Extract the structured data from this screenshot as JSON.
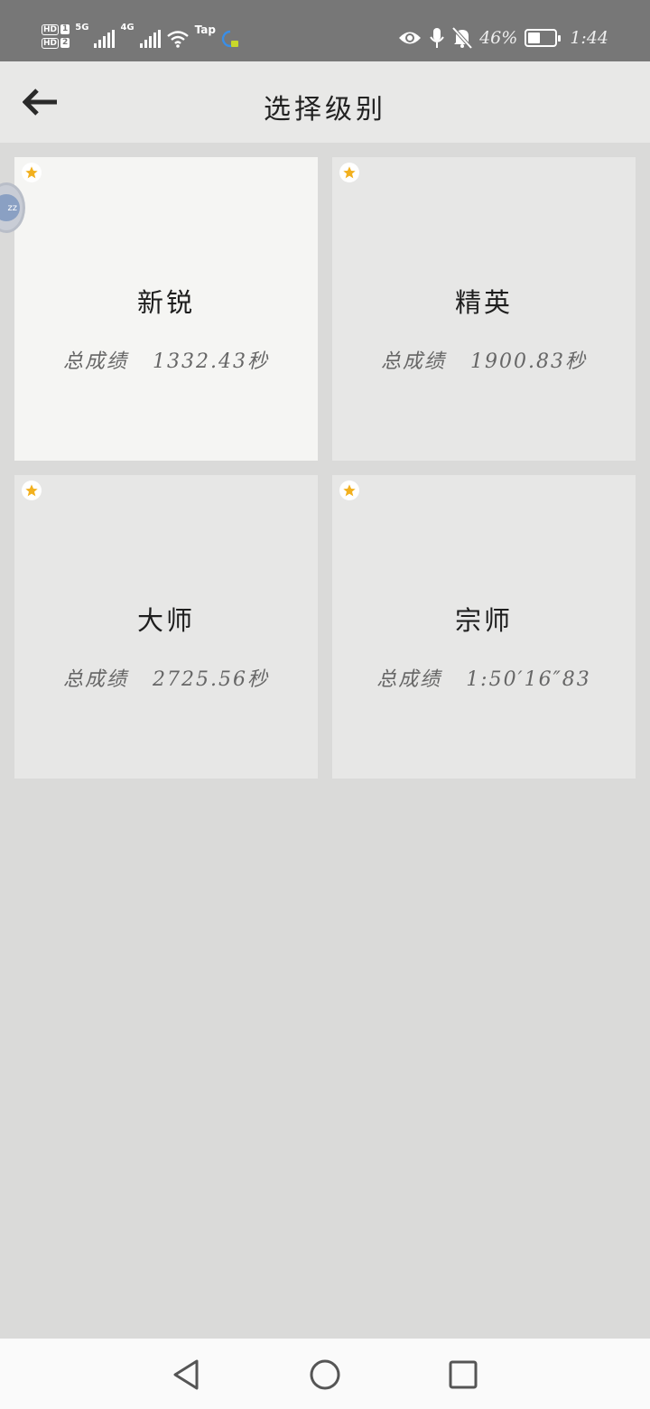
{
  "status_bar": {
    "sim1": "HD",
    "sim1_num": "1",
    "sim2": "HD",
    "sim2_num": "2",
    "network1": "5G",
    "network2": "4G",
    "tap_label": "Tap",
    "battery_percent_text": "46%",
    "battery_level": 0.46,
    "time": "1:44"
  },
  "header": {
    "title": "选择级别",
    "back_icon": "arrow-left-icon"
  },
  "levels": [
    {
      "name": "新锐",
      "score_label": "总成绩",
      "score": "1332.43秒",
      "starred": true
    },
    {
      "name": "精英",
      "score_label": "总成绩",
      "score": "1900.83秒",
      "starred": true
    },
    {
      "name": "大师",
      "score_label": "总成绩",
      "score": "2725.56秒",
      "starred": true
    },
    {
      "name": "宗师",
      "score_label": "总成绩",
      "score": "1:50′16″83",
      "starred": true
    }
  ],
  "floating_bubble": {
    "text": "zz"
  },
  "colors": {
    "star": "#f2b01e",
    "status_bar": "#777777",
    "page_bg": "#dadad9",
    "card_bg": "#e7e7e6",
    "card_active_bg": "#f5f5f3"
  },
  "nav": {
    "back_icon": "triangle-back-icon",
    "home_icon": "circle-home-icon",
    "recents_icon": "square-recents-icon"
  }
}
